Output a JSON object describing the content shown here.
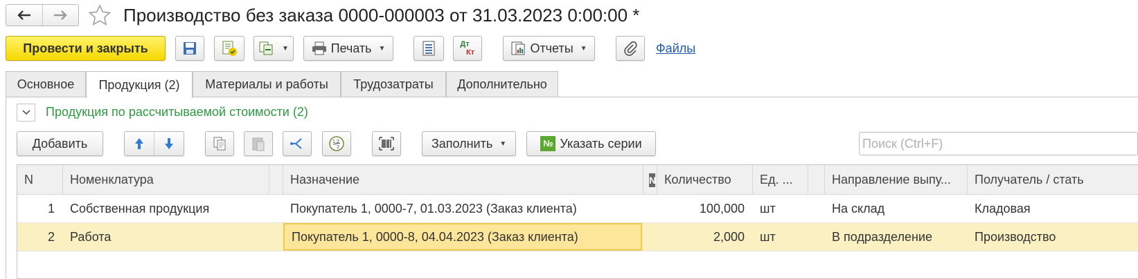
{
  "title": "Производство без заказа 0000-000003 от 31.03.2023 0:00:00 *",
  "toolbar": {
    "post_close_label": "Провести и закрыть",
    "print_label": "Печать",
    "reports_label": "Отчеты",
    "files_label": "Файлы",
    "dtkt_top": "Дт",
    "dtkt_bottom": "Кт"
  },
  "tabs": [
    {
      "label": "Основное",
      "active": false
    },
    {
      "label": "Продукция (2)",
      "active": true
    },
    {
      "label": "Материалы и работы",
      "active": false
    },
    {
      "label": "Трудозатраты",
      "active": false
    },
    {
      "label": "Дополнительно",
      "active": false
    }
  ],
  "group": {
    "title": "Продукция по рассчитываемой стоимости (2)"
  },
  "table_toolbar": {
    "add_label": "Добавить",
    "fill_label": "Заполнить",
    "series_label": "Указать серии",
    "series_icon_text": "№",
    "search_placeholder": "Поиск (Ctrl+F)"
  },
  "table": {
    "headers": [
      "N",
      "Номенклатура",
      "Назначение",
      "N",
      "Количество",
      "Ед. ...",
      "Направление выпу...",
      "Получатель / стать"
    ],
    "rows": [
      {
        "n": "1",
        "item": "Собственная продукция",
        "purpose": "Покупатель 1, 0000-7, 01.03.2023 (Заказ клиента)",
        "qty": "100,000",
        "unit": "шт",
        "direction": "На склад",
        "recipient": "Кладовая"
      },
      {
        "n": "2",
        "item": "Работа",
        "purpose": "Покупатель 1, 0000-8, 04.04.2023 (Заказ клиента)",
        "qty": "2,000",
        "unit": "шт",
        "direction": "В подразделение",
        "recipient": "Производство"
      }
    ]
  },
  "colors": {
    "accent_yellow": "#f5d800",
    "group_green": "#2d9a41",
    "link_blue": "#1c5bb0",
    "selected_row": "#fbf0c2"
  }
}
